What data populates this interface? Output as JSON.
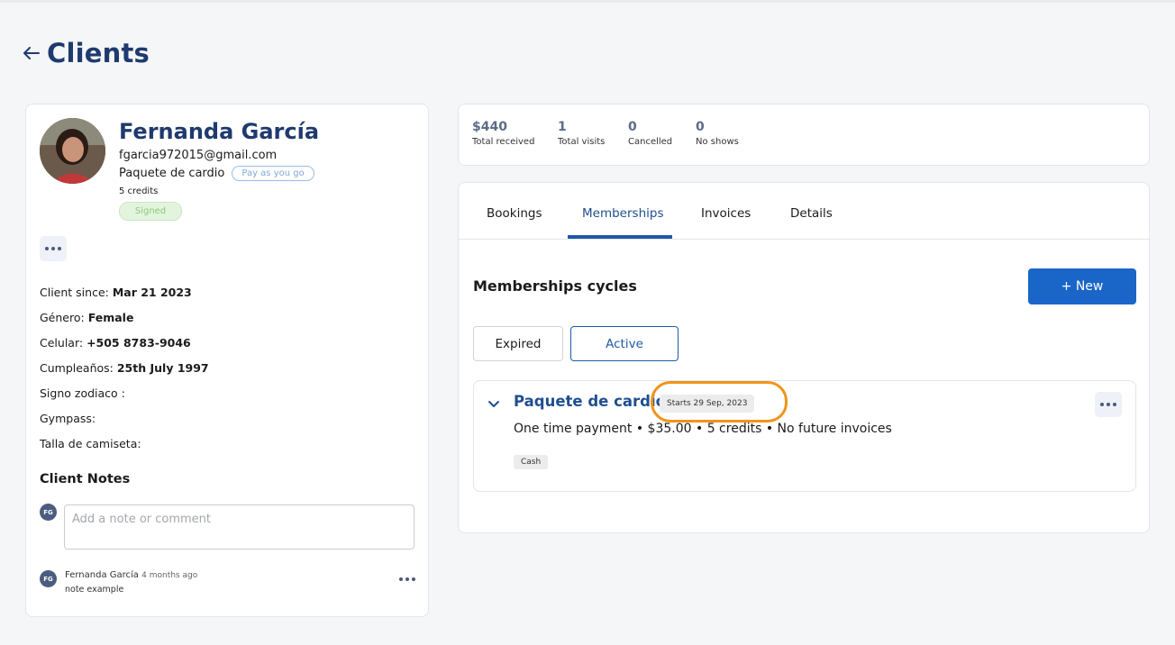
{
  "page": {
    "title": "Clients"
  },
  "client": {
    "name": "Fernanda García",
    "email": "fgarcia972015@gmail.com",
    "plan": "Paquete de cardio",
    "plan_badge": "Pay as you go",
    "credits": "5 credits",
    "status": "Signed",
    "info": [
      {
        "label": "Client since: ",
        "value": "Mar 21 2023"
      },
      {
        "label": "Género: ",
        "value": "Female"
      },
      {
        "label": "Celular: ",
        "value": "+505 8783-9046"
      },
      {
        "label": "Cumpleaños: ",
        "value": "25th July 1997"
      },
      {
        "label": "Signo zodiaco : ",
        "value": ""
      },
      {
        "label": "Gympass: ",
        "value": ""
      },
      {
        "label": "Talla de camiseta: ",
        "value": ""
      }
    ]
  },
  "notes": {
    "title": "Client Notes",
    "input_initials": "FG",
    "placeholder": "Add a note or comment",
    "items": [
      {
        "initials": "FG",
        "author": "Fernanda García",
        "time": "4 months ago",
        "text": "note example"
      }
    ]
  },
  "stats": [
    {
      "value": "$440",
      "label": "Total received"
    },
    {
      "value": "1",
      "label": "Total visits"
    },
    {
      "value": "0",
      "label": "Cancelled"
    },
    {
      "value": "0",
      "label": "No shows"
    }
  ],
  "tabs": [
    {
      "label": "Bookings",
      "active": false
    },
    {
      "label": "Memberships",
      "active": true
    },
    {
      "label": "Invoices",
      "active": false
    },
    {
      "label": "Details",
      "active": false
    }
  ],
  "memberships": {
    "section_title": "Memberships cycles",
    "new_button": "+ New",
    "filters": {
      "expired": "Expired",
      "active": "Active"
    },
    "selected_filter": "Active",
    "item": {
      "name": "Paquete de cardio",
      "start": "Starts 29 Sep, 2023",
      "details": "One time payment • $35.00 • 5 credits • No future invoices",
      "payment_method": "Cash"
    }
  },
  "colors": {
    "brand_navy": "#1f3a6e",
    "primary_blue": "#1a66c8",
    "highlight": "#f0941a",
    "signed_green": "#8cc97b"
  }
}
